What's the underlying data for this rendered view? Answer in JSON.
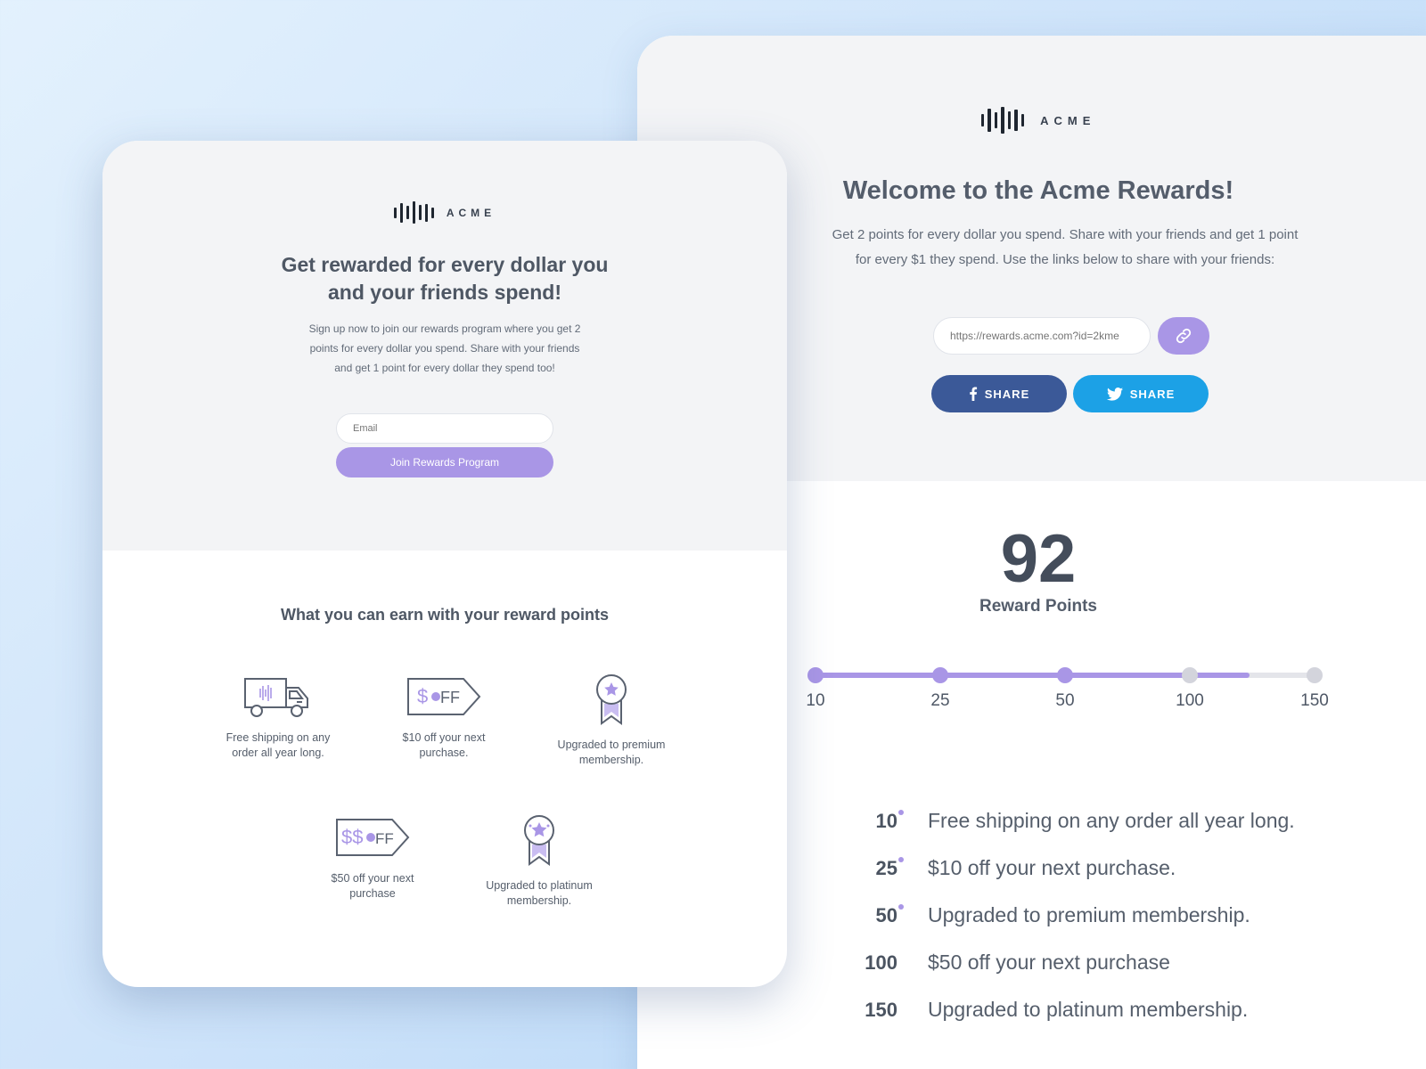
{
  "brand": {
    "name": "ACME"
  },
  "colors": {
    "accent": "#a996e6",
    "facebook": "#3b5998",
    "twitter": "#1ca1e6",
    "inactive": "#d3d4dc"
  },
  "signup": {
    "title_line1": "Get rewarded for every dollar you",
    "title_line2": "and your friends spend!",
    "desc_line1": "Sign up now to join our rewards program where you get 2",
    "desc_line2": "points for every dollar you spend. Share with your friends",
    "desc_line3": "and get 1 point for every dollar they spend too!",
    "email_placeholder": "Email",
    "join_label": "Join Rewards Program",
    "earn_title": "What you can earn with your reward points",
    "rewards": [
      {
        "icon": "truck-icon",
        "line1": "Free shipping on any",
        "line2": "order all year long."
      },
      {
        "icon": "dollar-off-tag-icon",
        "line1": "$10 off your next",
        "line2": "purchase."
      },
      {
        "icon": "ribbon-badge-icon",
        "line1": "Upgraded to premium",
        "line2": "membership."
      },
      {
        "icon": "double-dollar-off-tag-icon",
        "line1": "$50 off your next",
        "line2": "purchase"
      },
      {
        "icon": "platinum-ribbon-badge-icon",
        "line1": "Upgraded to platinum",
        "line2": "membership."
      }
    ]
  },
  "dashboard": {
    "title": "Welcome to the Acme Rewards!",
    "desc_line1": "Get 2 points for every dollar you spend. Share with your friends and get 1 point",
    "desc_line2": "for every $1 they spend. Use the links below to share with your friends:",
    "share_link": "https://rewards.acme.com?id=2kme",
    "share_facebook": "SHARE",
    "share_twitter": "SHARE",
    "points": "92",
    "points_label": "Reward Points",
    "progress": {
      "fill_fraction": 0.87,
      "milestones": [
        {
          "label": "10",
          "reached": true
        },
        {
          "label": "25",
          "reached": true
        },
        {
          "label": "50",
          "reached": true
        },
        {
          "label": "100",
          "reached": false
        },
        {
          "label": "150",
          "reached": false
        }
      ]
    },
    "tiers": [
      {
        "points": "10",
        "text": "Free shipping on any order all year long.",
        "reached": true
      },
      {
        "points": "25",
        "text": "$10 off your next purchase.",
        "reached": true
      },
      {
        "points": "50",
        "text": "Upgraded to premium membership.",
        "reached": true
      },
      {
        "points": "100",
        "text": "$50 off your next purchase",
        "reached": false
      },
      {
        "points": "150",
        "text": "Upgraded to platinum membership.",
        "reached": false
      }
    ]
  }
}
